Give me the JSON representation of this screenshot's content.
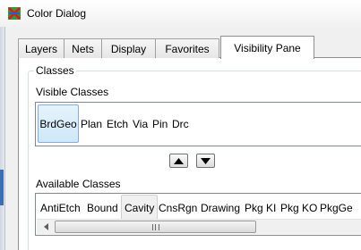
{
  "window": {
    "title": "Color Dialog",
    "icon": "color-dialog-app-icon"
  },
  "tabs": [
    {
      "label": "Layers",
      "active": false
    },
    {
      "label": "Nets",
      "active": false
    },
    {
      "label": "Display",
      "active": false
    },
    {
      "label": "Favorites",
      "active": false
    },
    {
      "label": "Visibility Pane",
      "active": true
    }
  ],
  "classes_group": {
    "legend": "Classes",
    "visible_label": "Visible Classes",
    "visible_items": [
      {
        "label": "BrdGeo",
        "state": "selected"
      },
      {
        "label": "Plan",
        "state": "normal"
      },
      {
        "label": "Etch",
        "state": "normal"
      },
      {
        "label": "Via",
        "state": "normal"
      },
      {
        "label": "Pin",
        "state": "normal"
      },
      {
        "label": "Drc",
        "state": "normal"
      }
    ],
    "move_up_icon": "triangle-up-icon",
    "move_down_icon": "triangle-down-icon",
    "available_label": "Available Classes",
    "available_items": [
      {
        "label": "AntiEtch",
        "state": "normal"
      },
      {
        "label": "Bound",
        "state": "normal"
      },
      {
        "label": "Cavity",
        "state": "hover"
      },
      {
        "label": "CnsRgn",
        "state": "normal"
      },
      {
        "label": "Drawing",
        "state": "normal"
      },
      {
        "label": "Pkg KI",
        "state": "normal"
      },
      {
        "label": "Pkg KO",
        "state": "normal"
      },
      {
        "label": "PkgGe",
        "state": "normal"
      }
    ]
  },
  "colors": {
    "selection_border": "#84acdd",
    "selection_fill": "#cfe8f8",
    "window_bg": "#f0f0f0",
    "panel_bg": "#ffffff"
  }
}
